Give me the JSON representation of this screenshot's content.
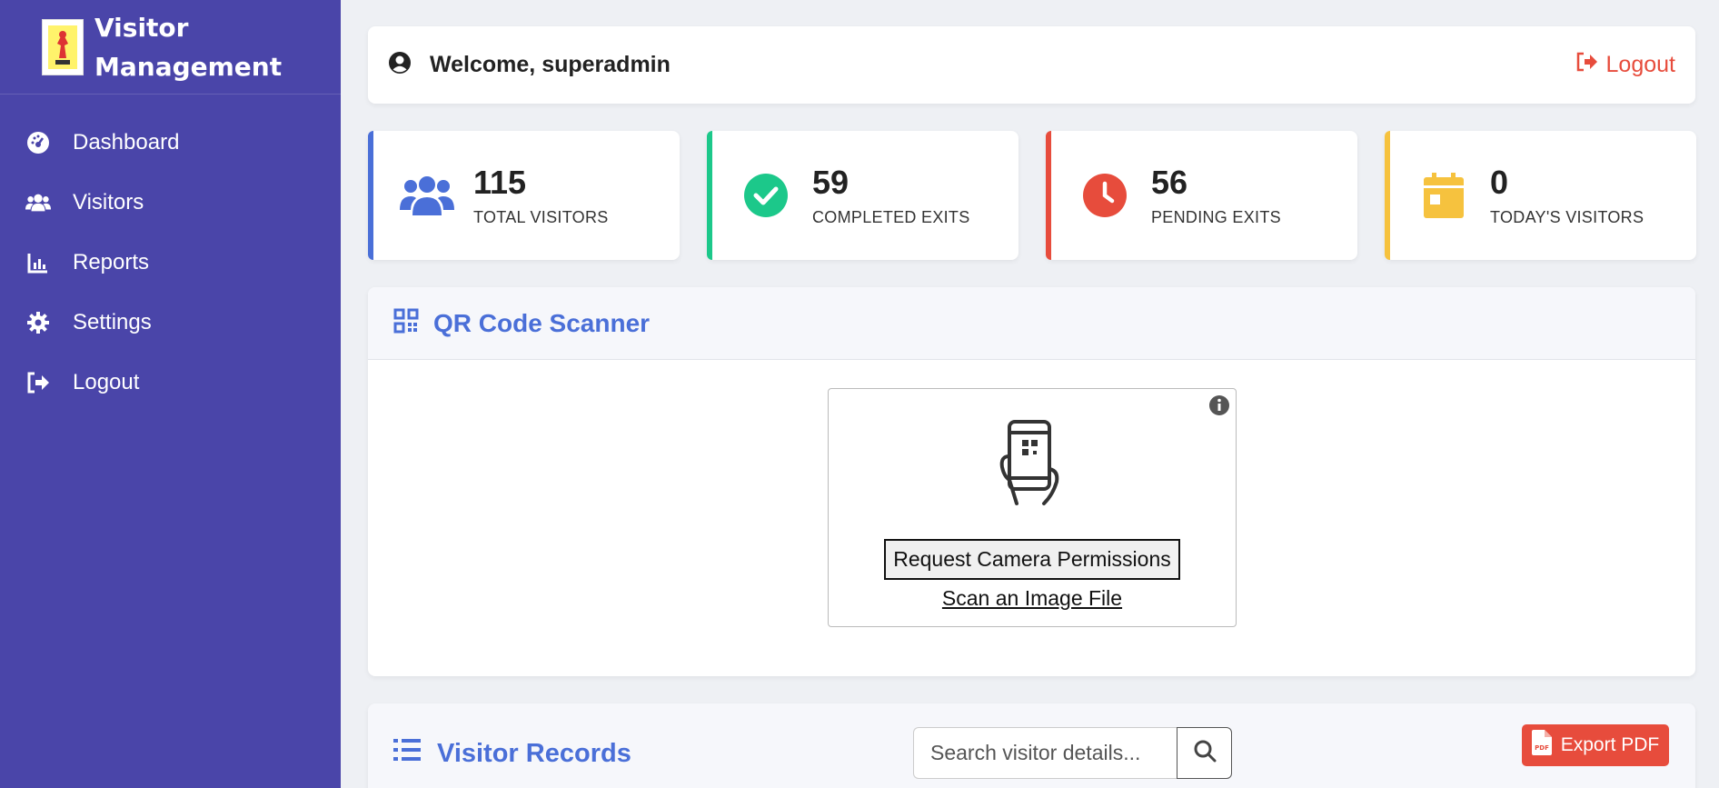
{
  "sidebar": {
    "brand_line1": "Visitor",
    "brand_line2": "Management",
    "items": [
      {
        "label": "Dashboard",
        "icon": "dashboard-icon"
      },
      {
        "label": "Visitors",
        "icon": "users-icon"
      },
      {
        "label": "Reports",
        "icon": "chart-icon"
      },
      {
        "label": "Settings",
        "icon": "gear-icon"
      },
      {
        "label": "Logout",
        "icon": "logout-icon"
      }
    ]
  },
  "header": {
    "welcome": "Welcome, superadmin",
    "logout_label": "Logout"
  },
  "stats": [
    {
      "value": "115",
      "label": "TOTAL VISITORS",
      "color": "#4a6fd8",
      "icon": "users-icon"
    },
    {
      "value": "59",
      "label": "COMPLETED EXITS",
      "color": "#1cc88a",
      "icon": "check-circle-icon"
    },
    {
      "value": "56",
      "label": "PENDING EXITS",
      "color": "#e74c3c",
      "icon": "clock-icon"
    },
    {
      "value": "0",
      "label": "TODAY'S VISITORS",
      "color": "#f6c23e",
      "icon": "calendar-icon"
    }
  ],
  "qr": {
    "title": "QR Code Scanner",
    "request_button": "Request Camera Permissions",
    "scan_link": "Scan an Image File"
  },
  "records": {
    "title": "Visitor Records",
    "search_placeholder": "Search visitor details...",
    "export_label": "Export PDF"
  },
  "colors": {
    "sidebar": "#4a45a9",
    "accent": "#4a6fd8",
    "danger": "#e74c3c"
  }
}
